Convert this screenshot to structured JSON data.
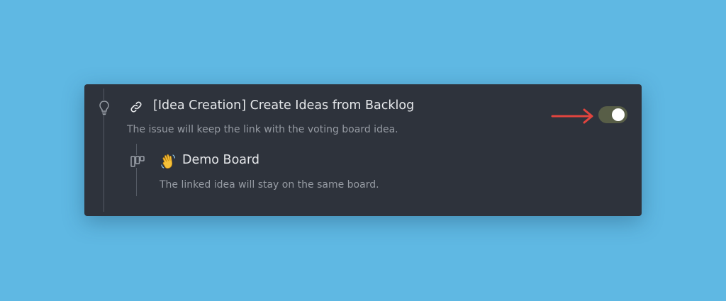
{
  "colors": {
    "background": "#5fb8e3",
    "card": "#2e333c",
    "title_text": "#e6e8eb",
    "secondary_text": "#969ba3",
    "toggle_on": "#585e47",
    "arrow": "#e0443e"
  },
  "rule": {
    "icon": "link-icon",
    "title": "[Idea Creation] Create Ideas from Backlog",
    "description": "The issue will keep the link with the voting board idea.",
    "enabled": true
  },
  "board": {
    "icon": "waving-hand-emoji",
    "name": "Demo Board",
    "description": "The linked idea will stay on the same board."
  },
  "annotation": {
    "icon": "red-arrow-icon",
    "points_to": "toggle-switch"
  }
}
